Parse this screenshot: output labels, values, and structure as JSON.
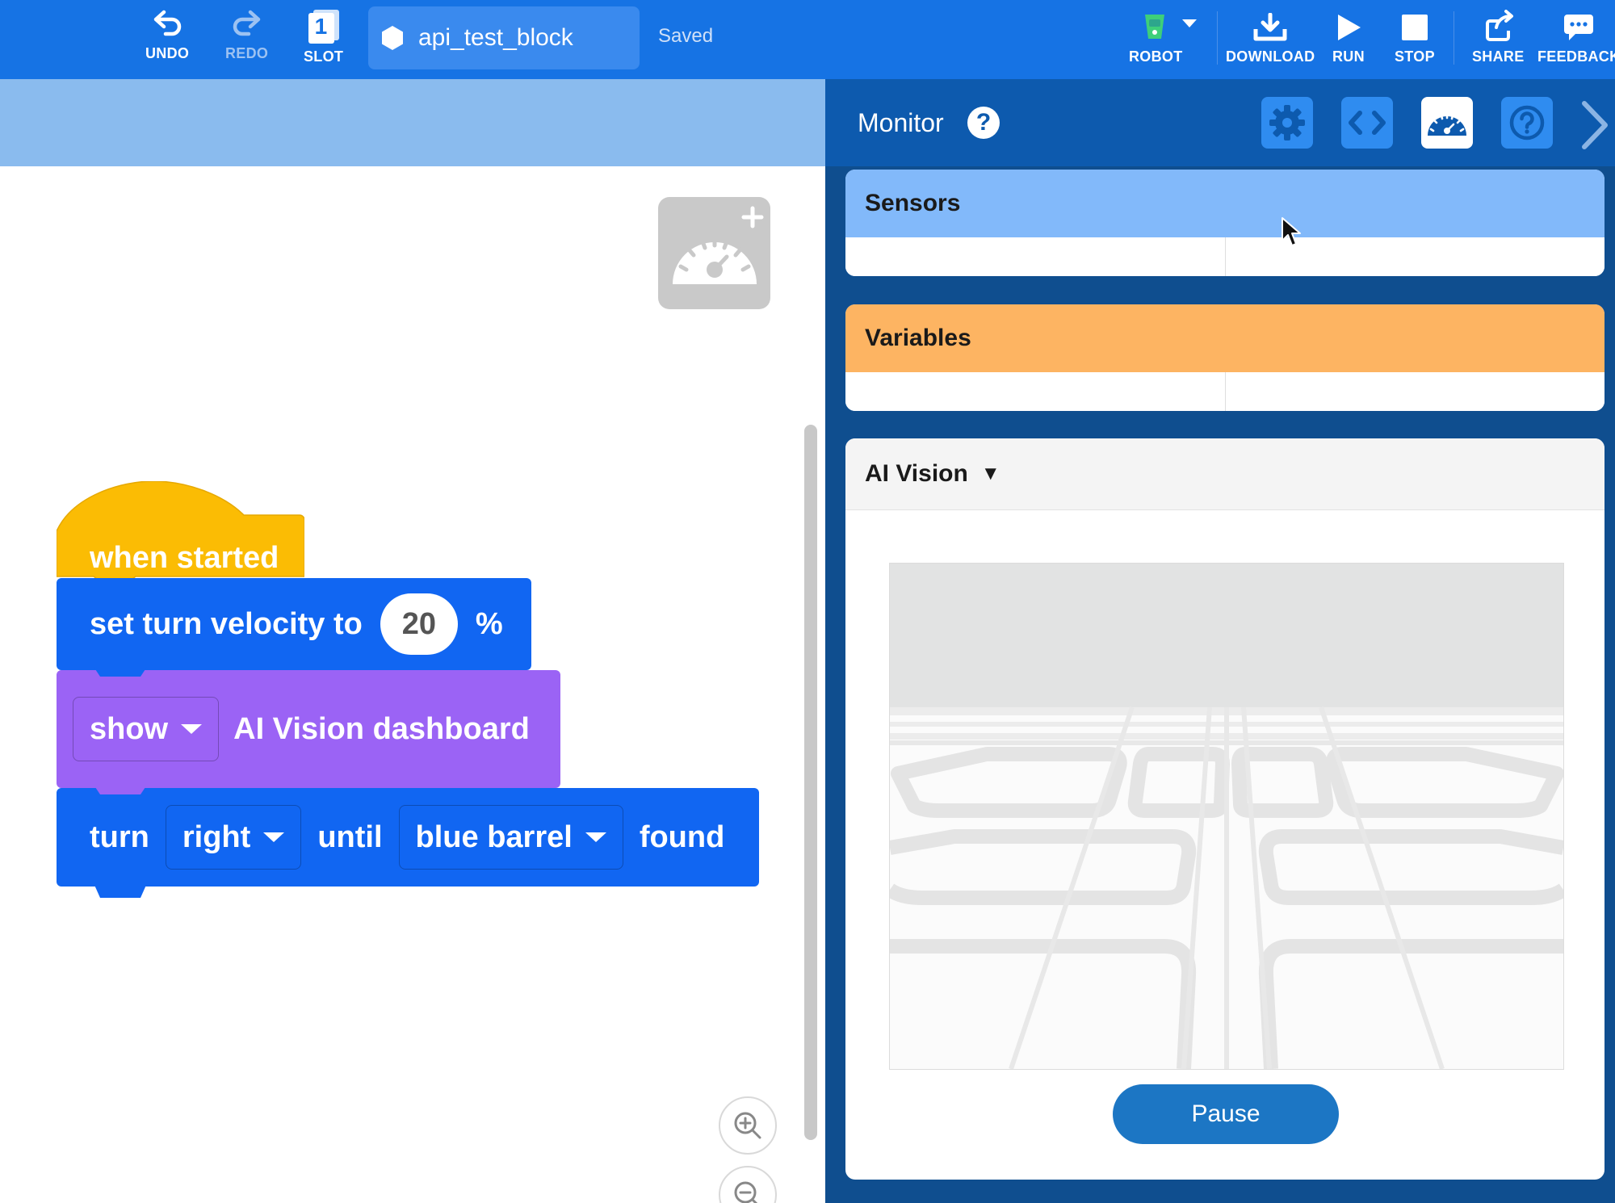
{
  "toolbar": {
    "undo_label": "UNDO",
    "redo_label": "REDO",
    "slot_label": "SLOT",
    "slot_number": "1",
    "file_name": "api_test_block",
    "save_status": "Saved",
    "robot_label": "ROBOT",
    "download_label": "DOWNLOAD",
    "run_label": "RUN",
    "stop_label": "STOP",
    "share_label": "SHARE",
    "feedback_label": "FEEDBACK"
  },
  "blocks": {
    "hat_label": "when started",
    "velocity": {
      "prefix": "set turn velocity to",
      "value": "20",
      "suffix": "%"
    },
    "show": {
      "mode": "show",
      "text": "AI Vision dashboard"
    },
    "turn": {
      "prefix": "turn",
      "direction": "right",
      "middle": "until",
      "object": "blue barrel",
      "suffix": "found"
    }
  },
  "monitor": {
    "title": "Monitor",
    "help_glyph": "?",
    "sensors_title": "Sensors",
    "variables_title": "Variables",
    "ai_vision_title": "AI Vision",
    "ai_vision_caret": "▼",
    "pause_label": "Pause"
  },
  "colors": {
    "toolbar": "#1673e4",
    "hat_block": "#fbbc04",
    "motion_block": "#1166f2",
    "looks_block": "#9b63f5",
    "sensors_header": "#82b9fa",
    "variables_header": "#fdb462",
    "panel_bg": "#0f4e8f",
    "pause_button": "#1c76c4"
  },
  "icons": {
    "undo": "undo-icon",
    "redo": "redo-icon",
    "slot": "slot-icon",
    "robot": "robot-icon",
    "download": "download-icon",
    "run": "play-icon",
    "stop": "stop-icon",
    "share": "share-icon",
    "feedback": "feedback-icon",
    "settings": "gear-icon",
    "code": "code-icon",
    "dashboard": "gauge-icon",
    "help": "help-icon"
  }
}
